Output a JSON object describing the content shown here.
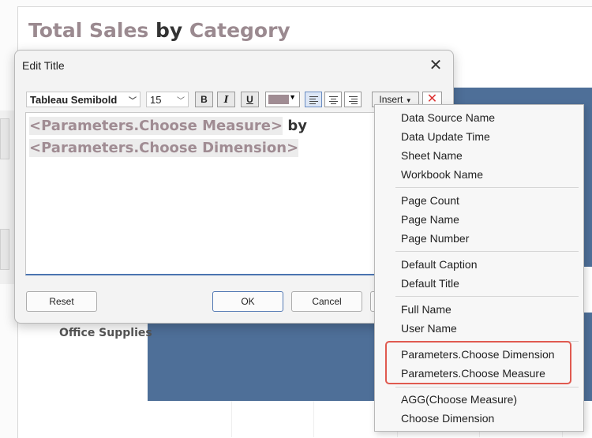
{
  "worksheet": {
    "title_part1": "Total Sales",
    "title_by": " by ",
    "title_part2": "Category",
    "row_label": "Office Supplies",
    "colors": {
      "bar": "#4e6f98",
      "title": "#9b8a90"
    }
  },
  "dialog": {
    "title": "Edit Title",
    "close_label": "✕",
    "toolbar": {
      "font": "Tableau Semibold",
      "size": "15",
      "bold": "B",
      "italic": "I",
      "underline": "U",
      "text_color": "#a08c93",
      "insert_label": "Insert",
      "delete_label": "✕"
    },
    "editor": {
      "line1_param": "<Parameters.Choose Measure>",
      "line1_text": " by",
      "line2_param": "<Parameters.Choose Dimension>"
    },
    "buttons": {
      "reset": "Reset",
      "ok": "OK",
      "cancel": "Cancel"
    }
  },
  "insert_menu": {
    "groups": [
      [
        "Data Source Name",
        "Data Update Time",
        "Sheet Name",
        "Workbook Name"
      ],
      [
        "Page Count",
        "Page Name",
        "Page Number"
      ],
      [
        "Default Caption",
        "Default Title"
      ],
      [
        "Full Name",
        "User Name"
      ],
      [
        "Parameters.Choose Dimension",
        "Parameters.Choose Measure"
      ],
      [
        "AGG(Choose Measure)",
        "Choose Dimension"
      ]
    ],
    "highlight_color": "#e05a50"
  }
}
